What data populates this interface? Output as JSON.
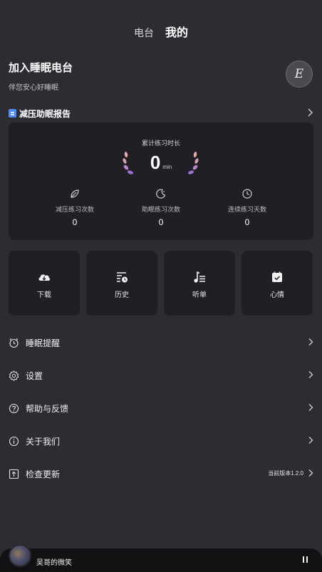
{
  "nav": {
    "tabs": [
      {
        "label": "电台",
        "active": false
      },
      {
        "label": "我的",
        "active": true
      }
    ]
  },
  "profile": {
    "title": "加入睡眠电台",
    "subtitle": "伴您安心好睡眠",
    "avatar_letter": "E"
  },
  "report": {
    "title": "减压助眠报告",
    "accumulated_label": "累计练习时长",
    "accumulated_value": "0",
    "accumulated_unit": "min",
    "stats": [
      {
        "label": "减压练习次数",
        "value": "0",
        "icon": "leaf-icon"
      },
      {
        "label": "助眠练习次数",
        "value": "0",
        "icon": "moon-icon"
      },
      {
        "label": "连续练习天数",
        "value": "0",
        "icon": "clock-icon"
      }
    ]
  },
  "tiles": [
    {
      "label": "下载",
      "icon": "download-cloud-icon"
    },
    {
      "label": "历史",
      "icon": "history-icon"
    },
    {
      "label": "听单",
      "icon": "playlist-icon"
    },
    {
      "label": "心情",
      "icon": "mood-calendar-icon"
    }
  ],
  "menu": [
    {
      "label": "睡眠提醒",
      "icon": "alarm-icon"
    },
    {
      "label": "设置",
      "icon": "gear-icon"
    },
    {
      "label": "帮助与反馈",
      "icon": "help-icon"
    },
    {
      "label": "关于我们",
      "icon": "info-icon"
    },
    {
      "label": "检查更新",
      "icon": "upload-icon",
      "extra": "当前版本1.2.0"
    }
  ],
  "player": {
    "song": "吴哥的微笑",
    "state": "playing"
  },
  "colors": {
    "background": "#2c2c32",
    "card": "#1f1f24",
    "laurel_top": "#e7a6a9",
    "laurel_bottom": "#9b6fd6",
    "badge": "#4f8ef0"
  }
}
